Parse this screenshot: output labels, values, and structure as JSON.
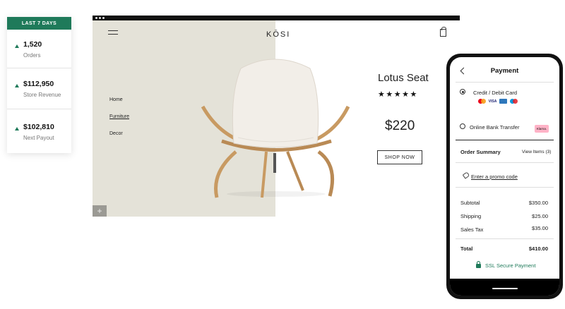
{
  "stats": {
    "header": "LAST 7 DAYS",
    "items": [
      {
        "value": "1,520",
        "label": "Orders"
      },
      {
        "value": "$112,950",
        "label": "Store Revenue"
      },
      {
        "value": "$102,810",
        "label": "Next Payout"
      }
    ],
    "accent_color": "#1f7a5a"
  },
  "store": {
    "logo": "KŌSI",
    "nav": [
      "Home",
      "Furniture",
      "Decor"
    ],
    "active_nav": "Furniture",
    "product": {
      "title": "Lotus Seat",
      "rating": "★★★★★",
      "price": "$220",
      "cta": "SHOP NOW"
    },
    "plus": "+",
    "icons": [
      "menu-icon",
      "shopping-bag-icon",
      "plus-icon"
    ]
  },
  "payment": {
    "title": "Payment",
    "options": [
      {
        "label": "Credit / Debit Card",
        "selected": true
      },
      {
        "label": "Online Bank Transfer",
        "selected": false
      }
    ],
    "card_logos": [
      "mastercard-icon",
      "visa-icon",
      "amex-icon",
      "maestro-icon"
    ],
    "visa_text": "VISA",
    "klarna_text": "Klarna.",
    "order_summary": "Order Summary",
    "view_items": "View Items (3)",
    "promo": "Enter a promo code",
    "lines": [
      {
        "label": "Subtotal",
        "value": "$350.00"
      },
      {
        "label": "Shipping",
        "value": "$25.00"
      },
      {
        "label": "Sales Tax",
        "value": "$35.00"
      }
    ],
    "total_label": "Total",
    "total_value": "$410.00",
    "secure": "SSL Secure Payment"
  }
}
